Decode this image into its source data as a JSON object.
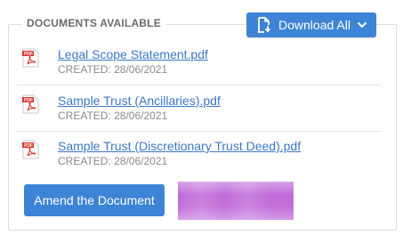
{
  "panel": {
    "title": "DOCUMENTS AVAILABLE"
  },
  "download_button": {
    "label": "Download All",
    "icon": "file-download-icon",
    "caret_icon": "chevron-down-icon"
  },
  "documents": [
    {
      "name": "Legal Scope Statement.pdf",
      "created": "CREATED: 28/06/2021",
      "icon": "pdf-file-icon"
    },
    {
      "name": "Sample Trust (Ancillaries).pdf",
      "created": "CREATED: 28/06/2021",
      "icon": "pdf-file-icon"
    },
    {
      "name": "Sample Trust (Discretionary Trust Deed).pdf",
      "created": "CREATED: 28/06/2021",
      "icon": "pdf-file-icon"
    }
  ],
  "amend_button": {
    "label": "Amend the Document"
  },
  "colors": {
    "accent": "#3d84d6",
    "link": "#3d77c4",
    "muted_text": "#8a8a8a",
    "pdf_red": "#d9342b",
    "redaction": "#c06ad8"
  }
}
